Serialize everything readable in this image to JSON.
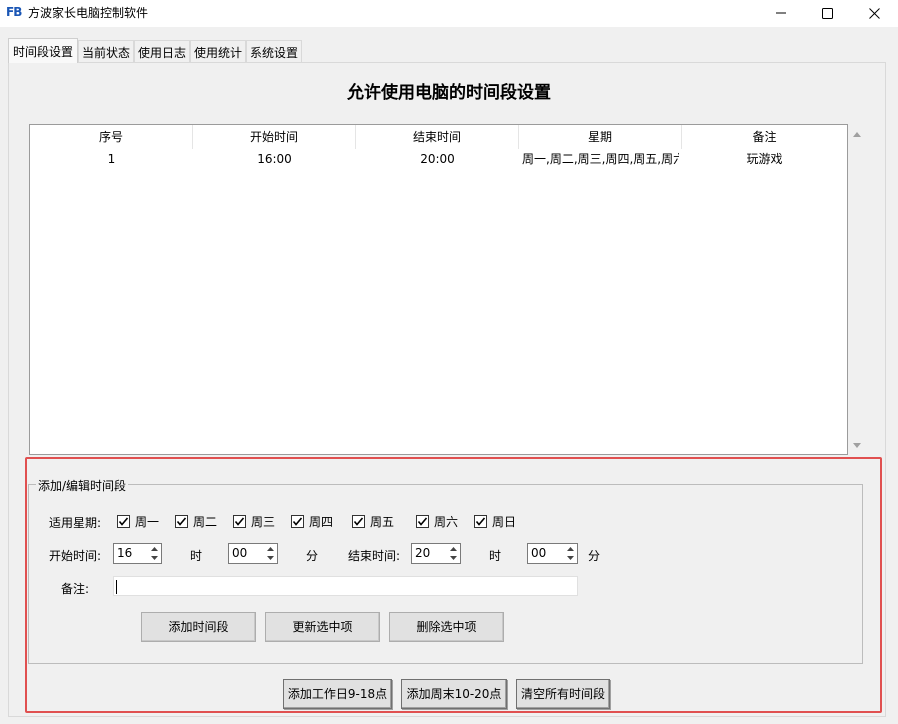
{
  "window": {
    "logo": "FB",
    "title": "方波家长电脑控制软件"
  },
  "tabs": [
    {
      "label": "时间段设置",
      "active": true
    },
    {
      "label": "当前状态",
      "active": false
    },
    {
      "label": "使用日志",
      "active": false
    },
    {
      "label": "使用统计",
      "active": false
    },
    {
      "label": "系统设置",
      "active": false
    }
  ],
  "page_title": "允许使用电脑的时间段设置",
  "table": {
    "columns": [
      "序号",
      "开始时间",
      "结束时间",
      "星期",
      "备注"
    ],
    "rows": [
      [
        "1",
        "16:00",
        "20:00",
        "周一,周二,周三,周四,周五,周六",
        "玩游戏"
      ]
    ]
  },
  "form": {
    "group_title": "添加/编辑时间段",
    "weekdays_label": "适用星期:",
    "weekdays": [
      {
        "label": "周一",
        "checked": true
      },
      {
        "label": "周二",
        "checked": true
      },
      {
        "label": "周三",
        "checked": true
      },
      {
        "label": "周四",
        "checked": true
      },
      {
        "label": "周五",
        "checked": true
      },
      {
        "label": "周六",
        "checked": true
      },
      {
        "label": "周日",
        "checked": true
      }
    ],
    "start_label": "开始时间:",
    "start_hour": "16",
    "hour_unit": "时",
    "start_minute": "00",
    "minute_unit": "分",
    "end_label": "结束时间:",
    "end_hour": "20",
    "end_minute": "00",
    "note_label": "备注:",
    "note_value": "",
    "add_button": "添加时间段",
    "update_button": "更新选中项",
    "delete_button": "删除选中项"
  },
  "quick_buttons": {
    "workday": "添加工作日9-18点",
    "weekend": "添加周末10-20点",
    "clear": "清空所有时间段"
  },
  "colors": {
    "highlight": "#e05050",
    "logo": "#1a56b5"
  }
}
